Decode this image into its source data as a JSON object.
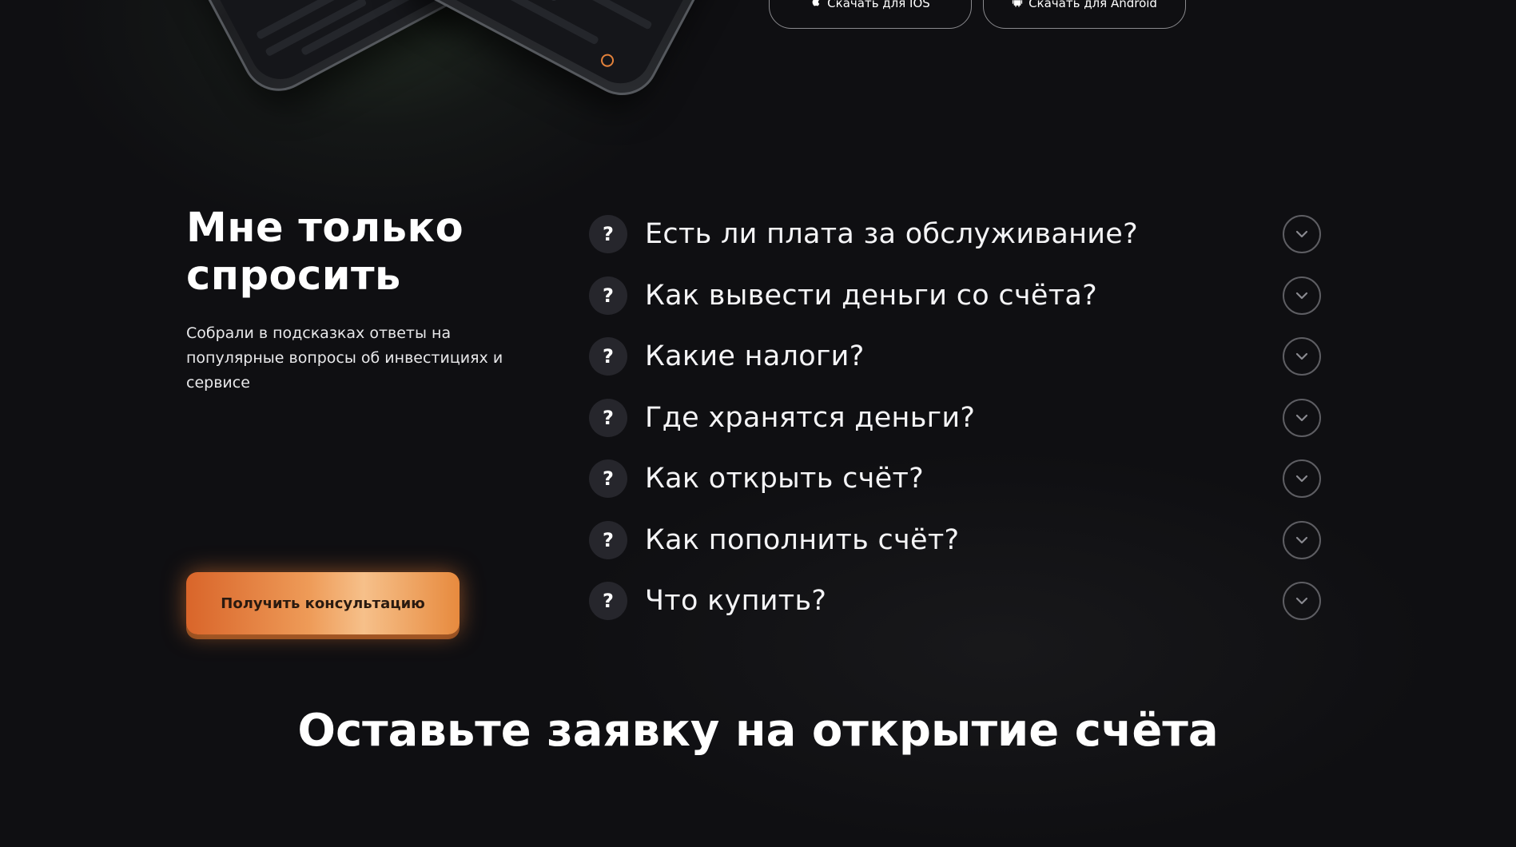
{
  "download": {
    "ios_label": "Скачать для IOS",
    "android_label": "Скачать для Android"
  },
  "faq": {
    "title_line1": "Мне только",
    "title_line2": "спросить",
    "subtitle": "Собрали в подсказках ответы на популярные вопросы об инвестициях и сервисе",
    "consult_button": "Получить консультацию",
    "question_mark": "?",
    "items": [
      {
        "question": "Есть ли плата за обслуживание?"
      },
      {
        "question": "Как вывести деньги со счёта?"
      },
      {
        "question": "Какие налоги?"
      },
      {
        "question": "Где хранятся деньги?"
      },
      {
        "question": "Как открыть счёт?"
      },
      {
        "question": "Как пополнить счёт?"
      },
      {
        "question": "Что купить?"
      }
    ]
  },
  "application": {
    "title": "Оставьте заявку на открытие счёта"
  },
  "colors": {
    "background": "#0f0f12",
    "accent_orange": "#e4823b",
    "question_circle": "#26262c",
    "chevron_border": "#5e5e63"
  }
}
